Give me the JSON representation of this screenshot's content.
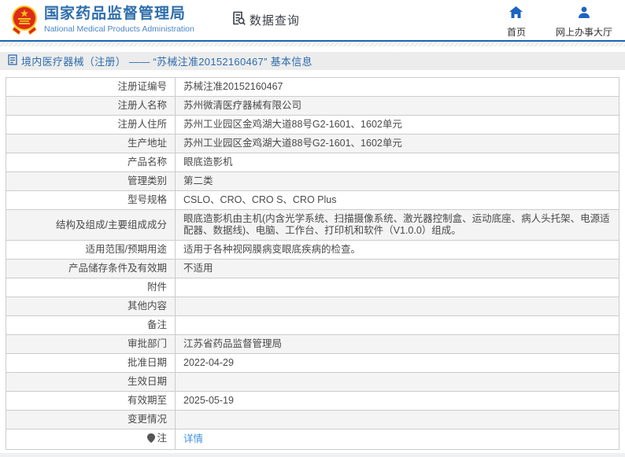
{
  "header": {
    "title": "国家药品监督管理局",
    "subtitle": "National Medical Products Administration",
    "data_query_label": "数据查询",
    "nav": [
      {
        "label": "首页",
        "icon": "home-icon"
      },
      {
        "label": "网上办事大厅",
        "icon": "user-icon"
      }
    ]
  },
  "breadcrumb": {
    "text": "境内医疗器械（注册） —— “苏械注准20152160467” 基本信息"
  },
  "table": {
    "rows": [
      {
        "label": "注册证编号",
        "value": "苏械注准20152160467"
      },
      {
        "label": "注册人名称",
        "value": "苏州微清医疗器械有限公司"
      },
      {
        "label": "注册人住所",
        "value": "苏州工业园区金鸡湖大道88号G2-1601、1602单元"
      },
      {
        "label": "生产地址",
        "value": "苏州工业园区金鸡湖大道88号G2-1601、1602单元"
      },
      {
        "label": "产品名称",
        "value": "眼底造影机"
      },
      {
        "label": "管理类别",
        "value": "第二类"
      },
      {
        "label": "型号规格",
        "value": "CSLO、CRO、CRO S、CRO Plus"
      },
      {
        "label": "结构及组成/主要组成成分",
        "value": "眼底造影机由主机(内含光学系统、扫描摄像系统、激光器控制盒、运动底座、病人头托架、电源适配器、数据线)、电脑、工作台、打印机和软件（V1.0.0）组成。"
      },
      {
        "label": "适用范围/预期用途",
        "value": "适用于各种视网膜病变眼底疾病的检查。"
      },
      {
        "label": "产品储存条件及有效期",
        "value": "不适用"
      },
      {
        "label": "附件",
        "value": ""
      },
      {
        "label": "其他内容",
        "value": ""
      },
      {
        "label": "备注",
        "value": ""
      },
      {
        "label": "审批部门",
        "value": "江苏省药品监督管理局"
      },
      {
        "label": "批准日期",
        "value": "2022-04-29"
      },
      {
        "label": "生效日期",
        "value": ""
      },
      {
        "label": "有效期至",
        "value": "2025-05-19"
      },
      {
        "label": "变更情况",
        "value": ""
      },
      {
        "label": "注",
        "value": "详情",
        "link": true,
        "icon": "pin-icon"
      }
    ]
  },
  "colors": {
    "brand_blue": "#2e6dab",
    "icon_blue": "#1d64c4",
    "line_blue": "#1b64b3",
    "link_blue": "#4191e0",
    "emblem_red": "#de2b18",
    "emblem_gold": "#f5c51d"
  }
}
